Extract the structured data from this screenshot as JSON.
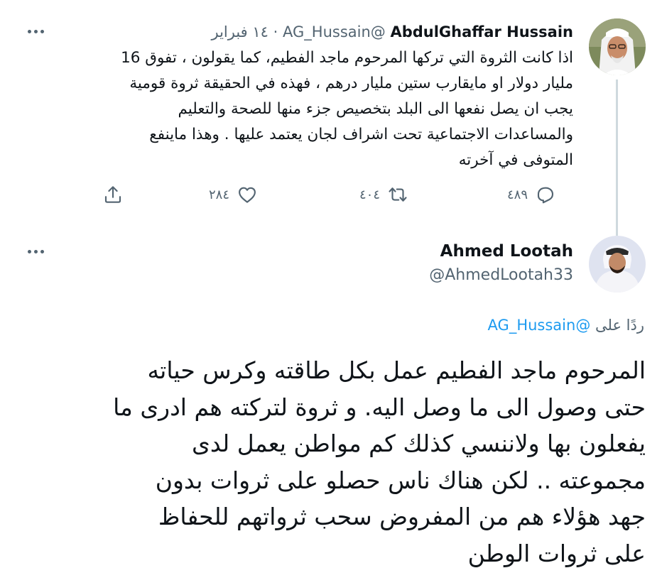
{
  "parent_tweet": {
    "author_name": "AbdulGhaffar Hussain",
    "author_handle": "@AG_Hussain",
    "separator": "·",
    "date": "١٤ فبراير",
    "avatar_icon": "avatar-photo",
    "body_lines": [
      "اذا كانت الثروة التي تركها المرحوم ماجد الفطيم، كما يقولون ، تفوق 16",
      "مليار دولار او مايقارب ستين مليار درهم ، فهذه في الحقيقة ثروة قومية",
      "يجب ان يصل نفعها الى البلد بتخصيص جزء منها للصحة والتعليم",
      "والمساعدات الاجتماعية تحت اشراف لجان يعتمد عليها . وهذا ماينفع",
      "المتوفى في آخرته"
    ],
    "actions": {
      "replies": "٤٨٩",
      "retweets": "٤٠٤",
      "likes": "٢٨٤"
    }
  },
  "reply_tweet": {
    "author_name": "Ahmed Lootah",
    "author_handle": "@AhmedLootah33",
    "avatar_icon": "avatar-photo",
    "reply_prefix": "ردًا على",
    "reply_mention": "@AG_Hussain",
    "body_lines": [
      "المرحوم ماجد الفطيم عمل بكل طاقته وكرس حياته",
      "حتى وصول الى ما وصل اليه. و ثروة لتركته هم ادرى ما",
      "يفعلون بها ولاننسي كذلك كم مواطن يعمل لدى",
      "مجموعته .. لكن هناك ناس حصلو على ثروات بدون",
      "جهد هؤلاء هم من المفروض سحب ثرواتهم للحفاظ",
      "على ثروات الوطن"
    ]
  },
  "colors": {
    "text_primary": "#0f1419",
    "text_secondary": "#536471",
    "link": "#1d9bf0",
    "thread_line": "#cfd9de"
  }
}
